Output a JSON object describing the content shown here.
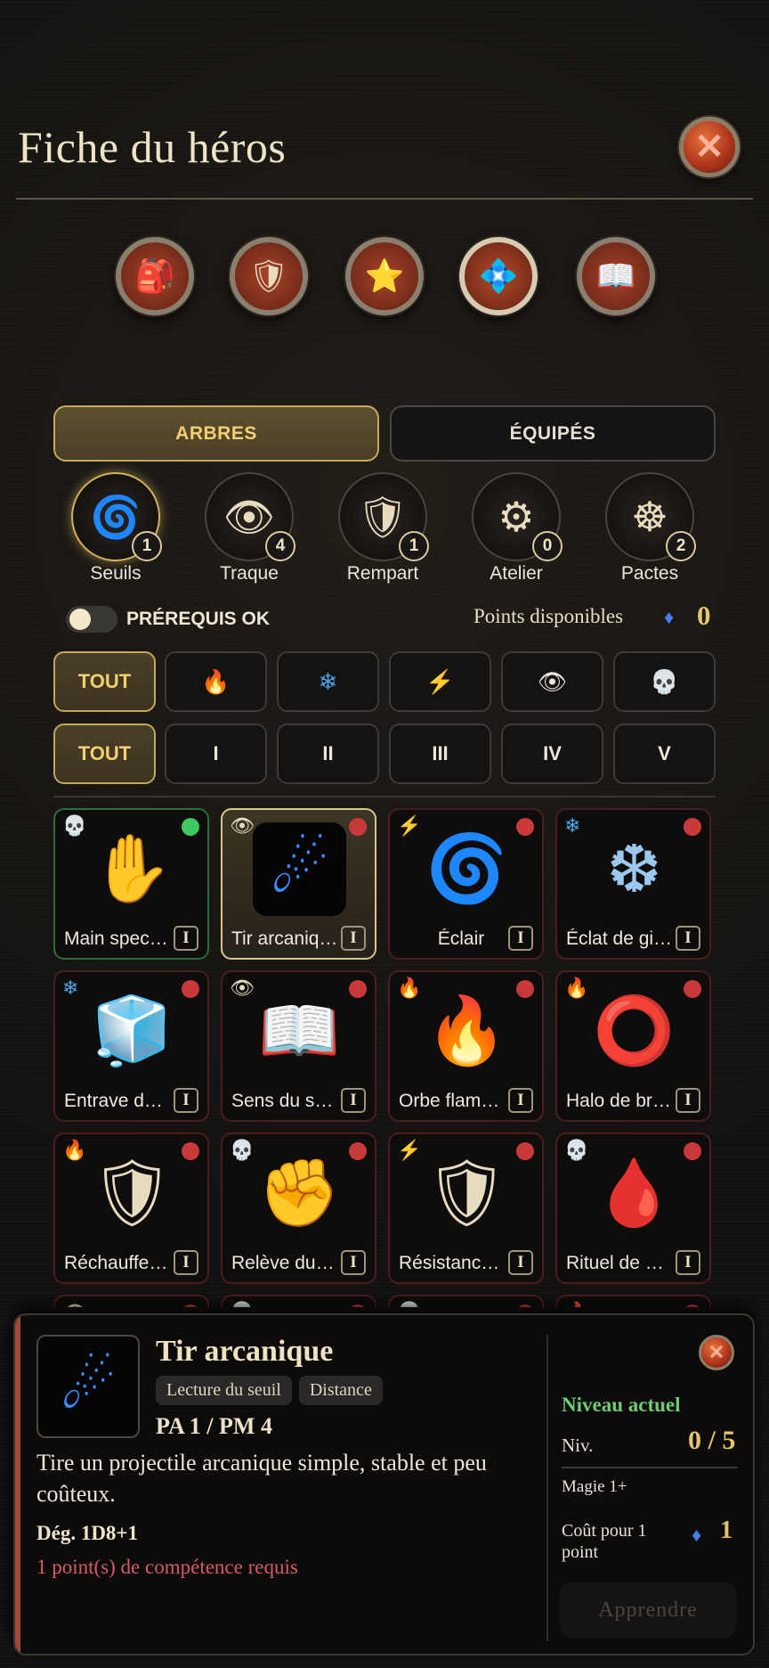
{
  "header": {
    "title": "Fiche du héros",
    "close_icon": "close-x-icon"
  },
  "top_tabs": [
    {
      "icon": "backpack-icon",
      "glyph": "🎒",
      "bg": "#7a3220"
    },
    {
      "icon": "shield-icon",
      "glyph": "🛡",
      "bg": "#7a3220"
    },
    {
      "icon": "star-icon",
      "glyph": "⭐",
      "bg": "#7a3220"
    },
    {
      "icon": "crystal-icon",
      "glyph": "💠",
      "bg": "#7a3220",
      "active": true
    },
    {
      "icon": "book-icon",
      "glyph": "📖",
      "bg": "#7a3220"
    }
  ],
  "segment": {
    "trees": "ARBRES",
    "equipped": "ÉQUIPÉS"
  },
  "trees": [
    {
      "label": "Seuils",
      "count": "1",
      "glyph": "🌀",
      "icon": "rune-portal-icon",
      "active": true
    },
    {
      "label": "Traque",
      "count": "4",
      "glyph": "👁",
      "icon": "hunting-eye-icon"
    },
    {
      "label": "Rempart",
      "count": "1",
      "glyph": "🛡",
      "icon": "rampart-shield-icon"
    },
    {
      "label": "Atelier",
      "count": "0",
      "glyph": "⚙",
      "icon": "gear-icon"
    },
    {
      "label": "Pactes",
      "count": "2",
      "glyph": "☸",
      "icon": "pact-sigil-icon"
    }
  ],
  "prereq": {
    "label": "PRÉREQUIS OK",
    "enabled": false
  },
  "points": {
    "label": "Points disponibles",
    "value": "0",
    "icon": "gem-icon"
  },
  "element_filters": [
    {
      "label": "TOUT",
      "active": true
    },
    {
      "icon": "fire-icon",
      "glyph": "🔥"
    },
    {
      "icon": "ice-icon",
      "glyph": "❄"
    },
    {
      "icon": "lightning-icon",
      "glyph": "⚡"
    },
    {
      "icon": "eye-icon",
      "glyph": "👁"
    },
    {
      "icon": "skull-icon",
      "glyph": "💀"
    }
  ],
  "tier_filters": [
    {
      "label": "TOUT",
      "active": true
    },
    {
      "label": "I"
    },
    {
      "label": "II"
    },
    {
      "label": "III"
    },
    {
      "label": "IV"
    },
    {
      "label": "V"
    }
  ],
  "skills": [
    {
      "name": "Main spect…",
      "tier": "I",
      "cat": "💀",
      "art": "✋",
      "status": "ok",
      "border": "green"
    },
    {
      "name": "Tir arcaniq…",
      "tier": "I",
      "cat": "👁",
      "art": "☄",
      "status": "locked",
      "selected": true
    },
    {
      "name": "Éclair",
      "tier": "I",
      "cat": "⚡",
      "art": "🌀",
      "status": "locked",
      "center": true
    },
    {
      "name": "Éclat de gi…",
      "tier": "I",
      "cat": "❄",
      "art": "❆",
      "status": "locked"
    },
    {
      "name": "Entrave de …",
      "tier": "I",
      "cat": "❄",
      "art": "🧊",
      "status": "locked"
    },
    {
      "name": "Sens du se…",
      "tier": "I",
      "cat": "👁",
      "art": "📖",
      "status": "locked"
    },
    {
      "name": "Orbe flamb…",
      "tier": "I",
      "cat": "🔥",
      "art": "🔥",
      "status": "locked"
    },
    {
      "name": "Halo de br…",
      "tier": "I",
      "cat": "🔥",
      "art": "⭕",
      "status": "locked"
    },
    {
      "name": "Réchauffe…",
      "tier": "I",
      "cat": "🔥",
      "art": "🛡",
      "status": "locked"
    },
    {
      "name": "Relève du …",
      "tier": "I",
      "cat": "💀",
      "art": "✊",
      "status": "locked"
    },
    {
      "name": "Résistance…",
      "tier": "I",
      "cat": "⚡",
      "art": "🛡",
      "status": "locked"
    },
    {
      "name": "Rituel de s…",
      "tier": "I",
      "cat": "💀",
      "art": "🩸",
      "status": "locked"
    },
    {
      "name": "",
      "tier": "",
      "cat": "👁",
      "art": "",
      "status": "locked"
    },
    {
      "name": "",
      "tier": "",
      "cat": "💀",
      "art": "",
      "status": "locked"
    },
    {
      "name": "",
      "tier": "",
      "cat": "💀",
      "art": "",
      "status": "locked"
    },
    {
      "name": "",
      "tier": "",
      "cat": "🔥",
      "art": "",
      "status": "locked"
    }
  ],
  "detail": {
    "title": "Tir arcanique",
    "tags": [
      "Lecture du seuil",
      "Distance"
    ],
    "pa_pm": "PA 1 / PM 4",
    "description": "Tire un projectile arcanique simple, stable et peu coûteux.",
    "damage": "Dég. 1D8+1",
    "requirement": "1 point(s) de compétence requis",
    "level_heading": "Niveau actuel",
    "level_label": "Niv.",
    "level_value": "0 / 5",
    "magic_req": "Magie 1+",
    "cost_label": "Coût pour 1 point",
    "cost_value": "1",
    "learn_button": "Apprendre"
  }
}
